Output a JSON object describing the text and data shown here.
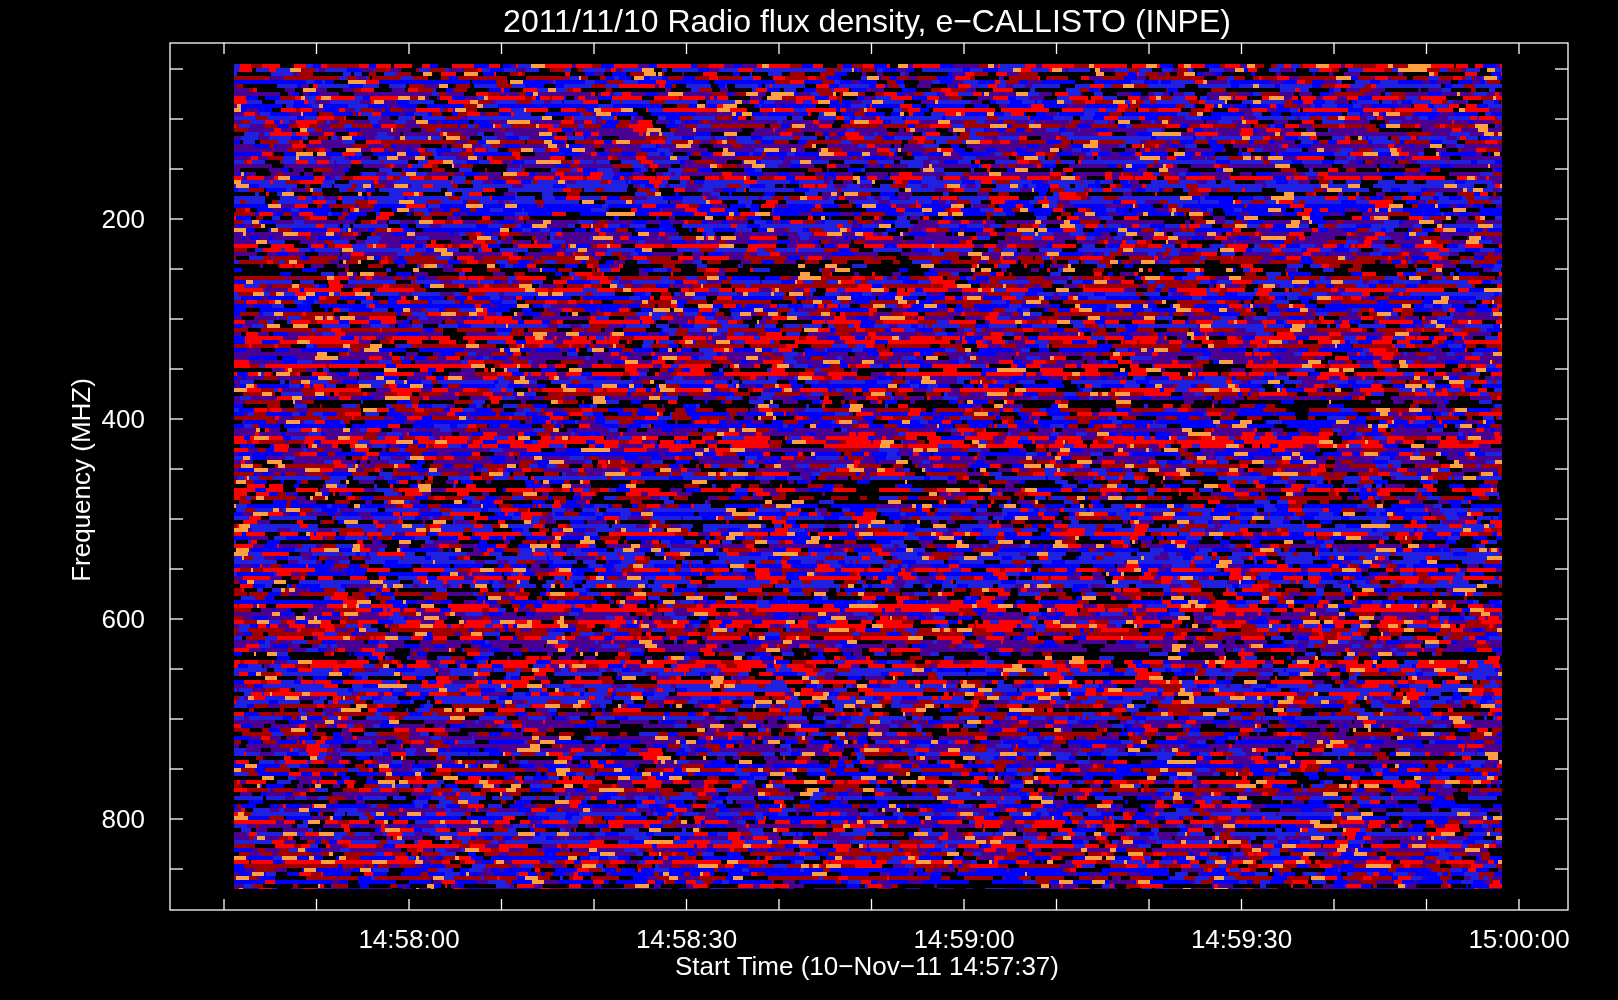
{
  "title": "2011/11/10  Radio flux density, e−CALLISTO (INPE)",
  "ylabel": "Frequency (MHZ)",
  "xlabel": "Start Time (10−Nov−11 14:57:37)",
  "y_ticks": [
    "200",
    "400",
    "600",
    "800"
  ],
  "x_ticks": [
    "14:58:00",
    "14:58:30",
    "14:59:00",
    "14:59:30",
    "15:00:00"
  ]
}
